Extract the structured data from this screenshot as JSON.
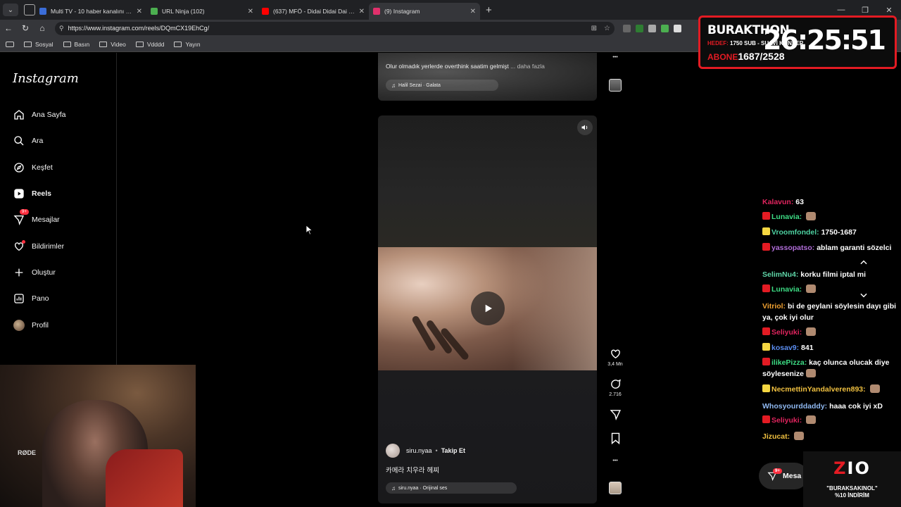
{
  "browser": {
    "tabs": [
      {
        "title": "Multi TV - 10 haber kanalını aynı a",
        "fav_color": "#3b6dd8"
      },
      {
        "title": "URL Ninja (102)",
        "fav_color": "#4caf50"
      },
      {
        "title": "(637) MFÖ - Didai Didai Dai - Türk",
        "fav_color": "#ff0000"
      },
      {
        "title": "(9) Instagram",
        "fav_color": "#e1306c"
      }
    ],
    "url": "https://www.instagram.com/reels/DQmCX19EhCg/",
    "bookmarks": [
      "Sosyal",
      "Basın",
      "Video",
      "Vdddd",
      "Yayın"
    ]
  },
  "sidebar": {
    "logo": "Instagram",
    "items": [
      {
        "label": "Ana Sayfa",
        "icon": "home-icon"
      },
      {
        "label": "Ara",
        "icon": "search-icon"
      },
      {
        "label": "Keşfet",
        "icon": "compass-icon"
      },
      {
        "label": "Reels",
        "icon": "reels-icon"
      },
      {
        "label": "Mesajlar",
        "icon": "messenger-icon",
        "badge": "9+"
      },
      {
        "label": "Bildirimler",
        "icon": "heart-icon"
      },
      {
        "label": "Oluştur",
        "icon": "plus-icon"
      },
      {
        "label": "Pano",
        "icon": "dashboard-icon"
      },
      {
        "label": "Profil",
        "icon": "avatar"
      }
    ]
  },
  "prev_reel": {
    "caption": "Olur olmadık yerlerde overthink saatim gelmişt",
    "more": "... daha fazla",
    "audio": "Halil Sezai · Galata"
  },
  "reel": {
    "username": "siru.nyaa",
    "follow": "Takip Et",
    "caption": "카메라 치우라 헤찌",
    "audio": "siru.nyaa · Orijinal ses",
    "likes": "3,4 Mn",
    "comments": "2.716"
  },
  "burakthon": {
    "name": "BURAKTHON",
    "goal_label": "HEDEF:",
    "goal": "1750 SUB - SUAVİ KONSER",
    "abone_label": "ABONE",
    "abone": "1687/2528",
    "timer": "26:25:51"
  },
  "chat": [
    {
      "user": "Kalavun:",
      "text": "63",
      "color": "#e0245e",
      "badge": false,
      "emote": false
    },
    {
      "user": "Lunavia:",
      "text": "",
      "color": "#3ddc84",
      "badge": "#e31b23",
      "emote": true
    },
    {
      "user": "Vroomfondel:",
      "text": "1750-1687",
      "color": "#4dd0a0",
      "badge": "#f5d742",
      "emote": false
    },
    {
      "user": "yassopatso:",
      "text": "ablam garanti sözelci",
      "color": "#b06dd8",
      "badge": "#e31b23",
      "emote": false
    },
    {
      "user": "SelimNu4:",
      "text": "korku filmi iptal mi",
      "color": "#5fd6a8",
      "badge": false,
      "emote": false
    },
    {
      "user": "Lunavia:",
      "text": "",
      "color": "#3ddc84",
      "badge": "#e31b23",
      "emote": true
    },
    {
      "user": "Vitriol:",
      "text": "bi de geylani söylesin dayı gibi ya, çok iyi olur",
      "color": "#f0a030",
      "badge": false,
      "emote": false
    },
    {
      "user": "Seliyuki:",
      "text": "",
      "color": "#e0245e",
      "badge": "#e31b23",
      "emote": true
    },
    {
      "user": "kosav9:",
      "text": "841",
      "color": "#5b8df0",
      "badge": "#f5d742",
      "emote": false
    },
    {
      "user": "ilikePizza:",
      "text": "kaç olunca olucak diye söylesenize",
      "color": "#3ddc84",
      "badge": "#e31b23",
      "emote": true
    },
    {
      "user": "NecmettinYandalveren893:",
      "text": "",
      "color": "#f0c040",
      "badge": "#f5d742",
      "emote": true
    },
    {
      "user": "Whosyourddaddy:",
      "text": "haaa cok iyi xD",
      "color": "#8fb8f0",
      "badge": false,
      "emote": false
    },
    {
      "user": "Seliyuki:",
      "text": "",
      "color": "#e0245e",
      "badge": "#e31b23",
      "emote": true
    },
    {
      "user": "Jizucat:",
      "text": "",
      "color": "#f0c040",
      "badge": false,
      "emote": true
    }
  ],
  "message_pill": {
    "label": "Mesa",
    "badge": "9+"
  },
  "zio": {
    "logo": "ZIO",
    "line1": "\"BURAKSAKINOL\"",
    "line2": "%10 İNDİRİM"
  },
  "webcam": {
    "mic_brand": "RØDE"
  },
  "colors": {
    "accent": "#e31b23",
    "ig_red": "#ff3040"
  }
}
